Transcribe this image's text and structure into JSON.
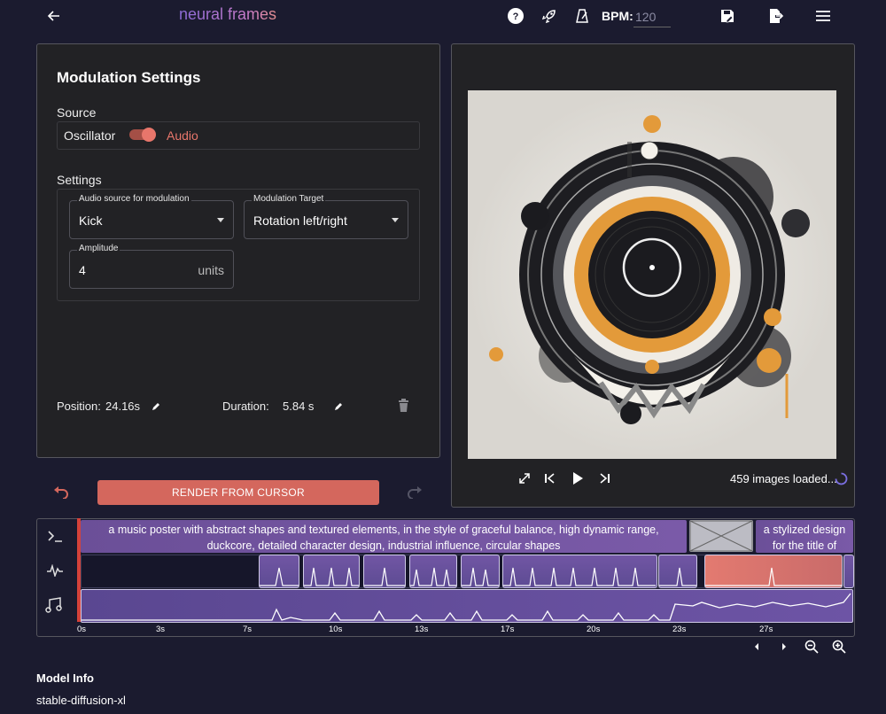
{
  "app": {
    "logo": "neural frames",
    "bpm_label": "BPM:",
    "bpm_value": "120",
    "accent": "#d4675d",
    "bg": "#1b1b2f"
  },
  "topbar": {
    "icons": [
      "arrow-left-icon",
      "help-icon",
      "rocket-icon",
      "metronome-icon",
      "save-icon",
      "export-icon",
      "menu-icon"
    ]
  },
  "modulation": {
    "title": "Modulation Settings",
    "source_label": "Source",
    "source_left": "Oscillator",
    "source_right": "Audio",
    "settings_label": "Settings",
    "audio_source": {
      "label": "Audio source for modulation",
      "value": "Kick"
    },
    "target": {
      "label": "Modulation Target",
      "value": "Rotation left/right"
    },
    "amplitude": {
      "label": "Amplitude",
      "value": "4",
      "unit": "units"
    },
    "position_label": "Position:",
    "position_value": "24.16s",
    "duration_label": "Duration:",
    "duration_value": "5.84 s"
  },
  "render": {
    "label": "RENDER FROM CURSOR"
  },
  "preview": {
    "status": "459 images loaded..."
  },
  "timeline": {
    "prompts": [
      "a music poster with abstract shapes and textured elements, in the style of graceful balance, high dynamic range, duckcore, detailed character design, industrial influence, circular shapes",
      "a stylized design for the title of"
    ],
    "ticks": [
      "0s",
      "3s",
      "7s",
      "10s",
      "13s",
      "17s",
      "20s",
      "23s",
      "27s"
    ]
  },
  "model": {
    "heading": "Model Info",
    "value": "stable-diffusion-xl"
  }
}
